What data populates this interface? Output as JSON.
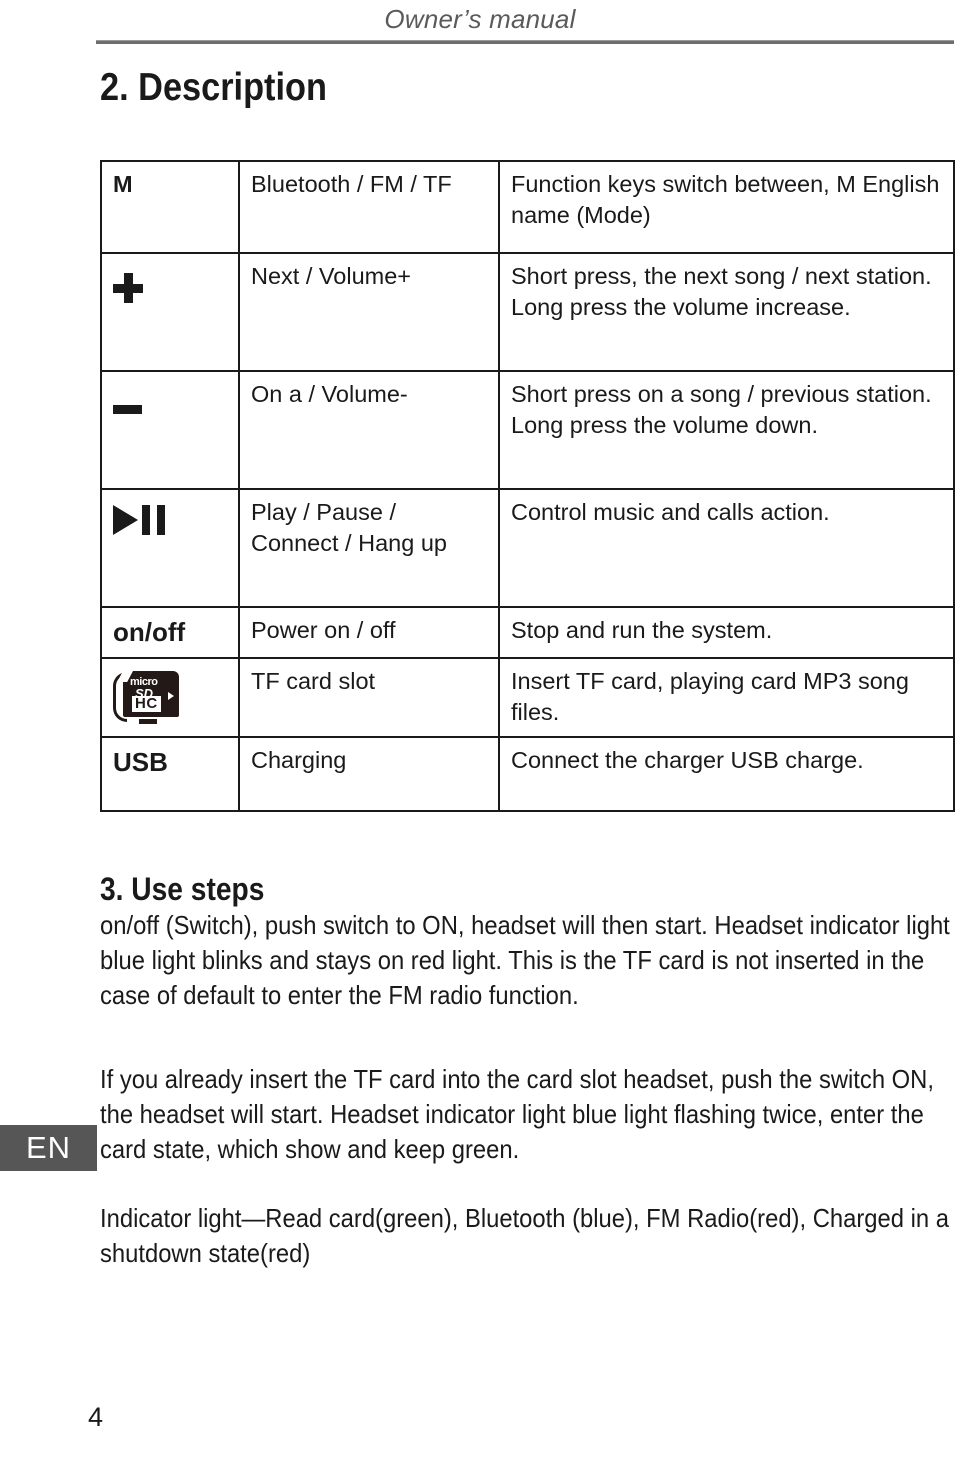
{
  "header": {
    "running_title": "Owner’s manual"
  },
  "sections": {
    "description_heading": "2. Description",
    "usesteps_heading": "3. Use steps"
  },
  "table": {
    "rows": [
      {
        "key_label": "M",
        "key_icon": "letter-m",
        "function": "Bluetooth / FM / TF",
        "description": "Function keys switch between, M English name (Mode)"
      },
      {
        "key_label": "+",
        "key_icon": "plus-icon",
        "function": "Next / Volume+",
        "description": "Short press, the next song / next station. Long press the volume increase."
      },
      {
        "key_label": "-",
        "key_icon": "minus-icon",
        "function": "On a / Volume-",
        "description": "Short press on a song / previous station. Long press the volume down."
      },
      {
        "key_label": "▶❘❘",
        "key_icon": "play-pause-icon",
        "function": "Play / Pause / Connect / Hang up",
        "description": "Control music and calls action."
      },
      {
        "key_label": "on/off",
        "key_icon": "onoff-text",
        "function": "Power on / off",
        "description": "Stop and run the system."
      },
      {
        "key_label": "microSDHC",
        "key_icon": "microsd-card-icon",
        "function": "TF card slot",
        "description": "Insert TF card, playing card MP3 song files."
      },
      {
        "key_label": "USB",
        "key_icon": "usb-text",
        "function": "Charging",
        "description": "Connect the charger USB charge."
      }
    ],
    "sd_icon_text": {
      "micro": "micro",
      "sd": "SD",
      "hc": "HC"
    }
  },
  "body": {
    "paragraph_1": "on/off (Switch), push switch to ON, headset will then start. Headset indicator light blue light blinks and stays on red light. This is the TF card is not inserted in the case of default to enter the FM radio function.",
    "paragraph_2": "If you already insert the TF card into the card slot headset, push the switch ON, the headset will start. Headset indicator light blue light flashing twice, enter the card state, which show and keep green.",
    "paragraph_3": "Indicator light—Read card(green), Bluetooth (blue), FM Radio(red), Charged in a shutdown state(red)"
  },
  "language_tab": "EN",
  "page_number": "4",
  "colors": {
    "text": "#1a1a1a",
    "header_text": "#5a5a5a",
    "rule": "#6e6e6e",
    "lang_tab_bg": "#565656",
    "sd_card": "#231a17"
  }
}
